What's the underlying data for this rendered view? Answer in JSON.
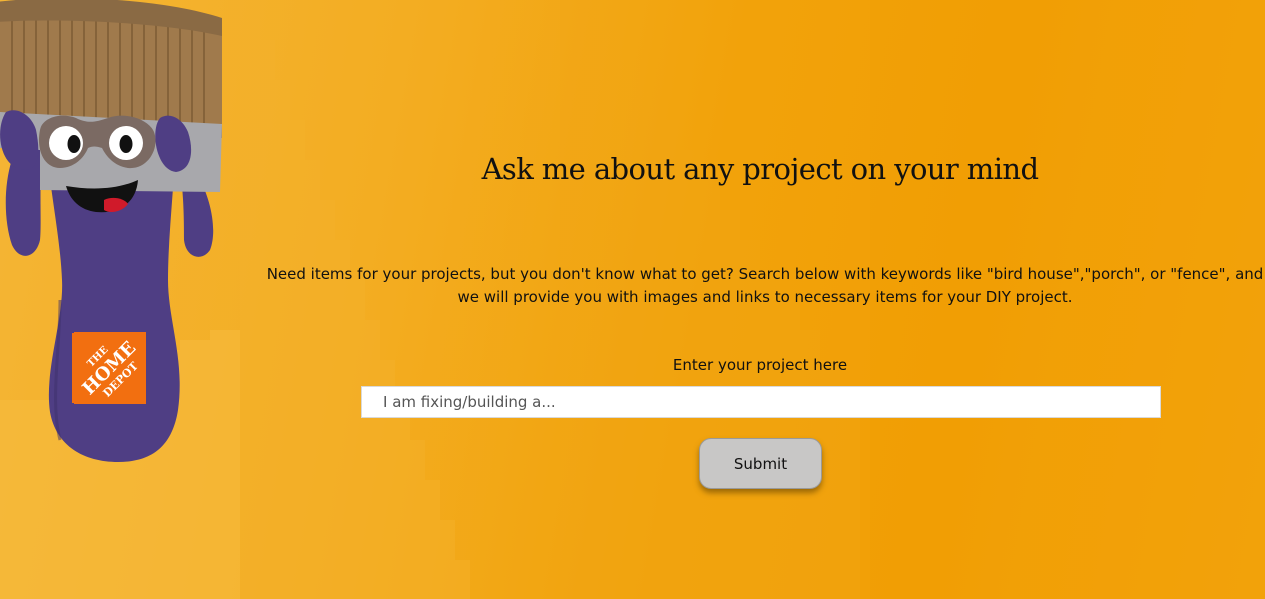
{
  "page": {
    "heading": "Ask me about any project on your mind",
    "intro": "Need items for your projects, but you don't know what to get? Search below with keywords like \"bird house\",\"porch\", or \"fence\", and we will provide you with images and links to necessary items for your DIY project."
  },
  "search": {
    "label": "Enter your project here",
    "placeholder": "I am fixing/building a...",
    "value": "",
    "submit_label": "Submit"
  },
  "mascot": {
    "icon": "paintbrush-mascot-icon",
    "logo_lines": [
      "THE",
      "HOME",
      "DEPOT"
    ]
  },
  "colors": {
    "background_left": "#f4b535",
    "background_right": "#f29f06",
    "mascot_body": "#4f3e84",
    "logo": "#f26f10",
    "button": "#c8c7c6"
  }
}
